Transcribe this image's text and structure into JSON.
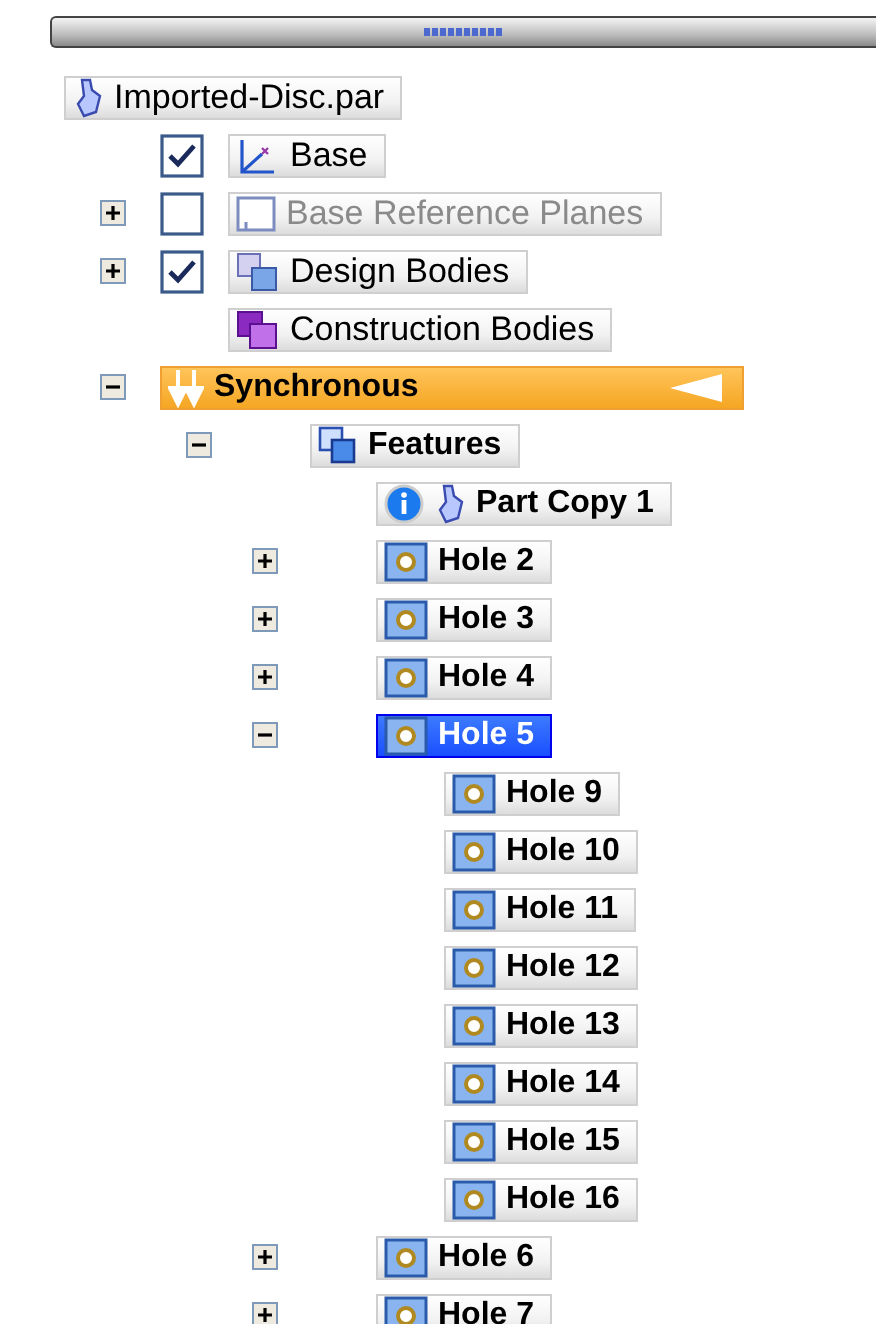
{
  "tree": [
    {
      "label": "Imported-Disc.par",
      "kind": "part",
      "selected": false,
      "children": [
        {
          "label": "Base",
          "kind": "coordinate",
          "checked": true,
          "selected": false
        },
        {
          "label": "Base Reference Planes",
          "kind": "planes",
          "checked": false,
          "expanded": false,
          "disabled": true,
          "selected": false
        },
        {
          "label": "Design Bodies",
          "kind": "bodies",
          "checked": true,
          "expanded": false,
          "selected": false
        },
        {
          "label": "Construction Bodies",
          "kind": "construction",
          "selected": false
        },
        {
          "label": "Synchronous",
          "kind": "environment",
          "expanded": true,
          "selected": false,
          "children": [
            {
              "label": "Features",
              "kind": "group",
              "expanded": true,
              "selected": false,
              "children": [
                {
                  "label": "Part Copy 1",
                  "kind": "part-copy",
                  "selected": false
                },
                {
                  "label": "Hole 2",
                  "kind": "hole",
                  "expanded": false,
                  "selected": false
                },
                {
                  "label": "Hole 3",
                  "kind": "hole",
                  "expanded": false,
                  "selected": false
                },
                {
                  "label": "Hole 4",
                  "kind": "hole",
                  "expanded": false,
                  "selected": false
                },
                {
                  "label": "Hole 5",
                  "kind": "hole",
                  "expanded": true,
                  "selected": true,
                  "children": [
                    {
                      "label": "Hole 9",
                      "kind": "hole",
                      "selected": false
                    },
                    {
                      "label": "Hole 10",
                      "kind": "hole",
                      "selected": false
                    },
                    {
                      "label": "Hole 11",
                      "kind": "hole",
                      "selected": false
                    },
                    {
                      "label": "Hole 12",
                      "kind": "hole",
                      "selected": false
                    },
                    {
                      "label": "Hole 13",
                      "kind": "hole",
                      "selected": false
                    },
                    {
                      "label": "Hole 14",
                      "kind": "hole",
                      "selected": false
                    },
                    {
                      "label": "Hole 15",
                      "kind": "hole",
                      "selected": false
                    },
                    {
                      "label": "Hole 16",
                      "kind": "hole",
                      "selected": false
                    }
                  ]
                },
                {
                  "label": "Hole 6",
                  "kind": "hole",
                  "expanded": false,
                  "selected": false
                },
                {
                  "label": "Hole 7",
                  "kind": "hole",
                  "expanded": false,
                  "selected": false
                }
              ]
            }
          ]
        }
      ]
    }
  ]
}
